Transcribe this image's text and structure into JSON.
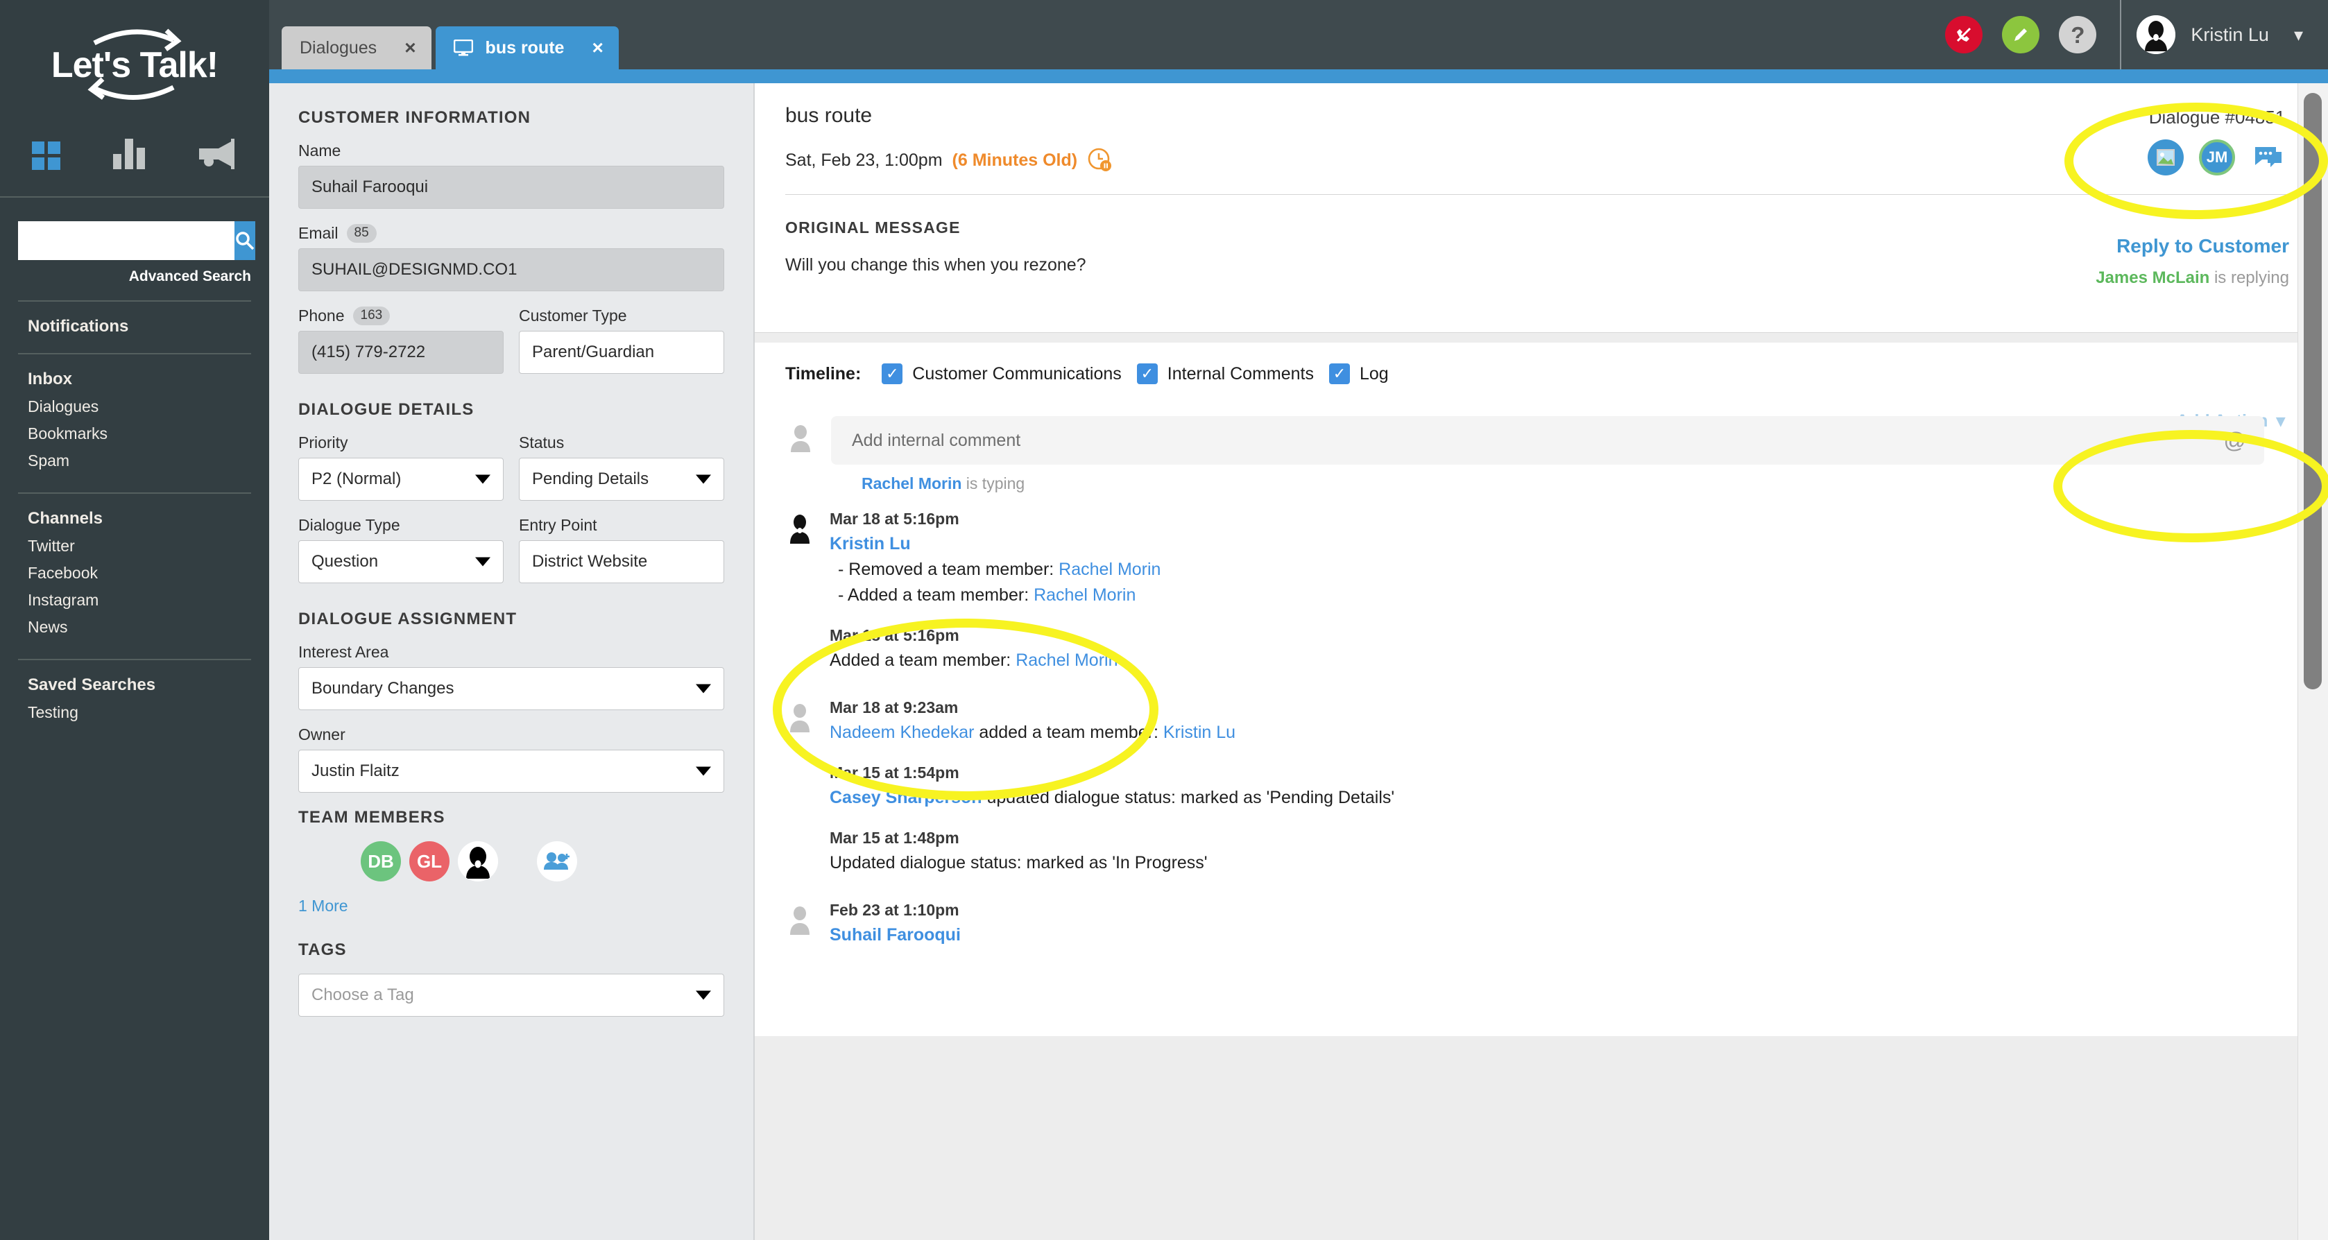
{
  "brand": {
    "name": "Let's Talk!",
    "accent": "#3f96d2",
    "sidebar_bg": "#333e42"
  },
  "sidebar": {
    "search": {
      "value": "",
      "placeholder": ""
    },
    "advanced_search_label": "Advanced Search",
    "notifications_label": "Notifications",
    "groups": [
      {
        "head": "Inbox",
        "items": [
          "Dialogues",
          "Bookmarks",
          "Spam"
        ]
      },
      {
        "head": "Channels",
        "items": [
          "Twitter",
          "Facebook",
          "Instagram",
          "News"
        ]
      },
      {
        "head": "Saved Searches",
        "items": [
          "Testing"
        ]
      }
    ]
  },
  "topbar": {
    "tabs": [
      {
        "label": "Dialogues",
        "active": false,
        "close": "×"
      },
      {
        "label": "bus route",
        "active": true,
        "close": "×"
      }
    ],
    "icons": [
      "phone-off-icon",
      "pencil-icon",
      "help-icon"
    ],
    "user": {
      "name": "Kristin Lu",
      "caret": "⌄"
    }
  },
  "detail_panel": {
    "customer_information": {
      "title": "CUSTOMER INFORMATION",
      "name": {
        "label": "Name",
        "value": "Suhail Farooqui"
      },
      "email": {
        "label": "Email",
        "count": "85",
        "value": "SUHAIL@DESIGNMD.CO1"
      },
      "phone": {
        "label": "Phone",
        "count": "163",
        "value": "(415) 779-2722"
      },
      "customer_type": {
        "label": "Customer Type",
        "value": "Parent/Guardian"
      }
    },
    "dialogue_details": {
      "title": "DIALOGUE DETAILS",
      "priority": {
        "label": "Priority",
        "value": "P2 (Normal)"
      },
      "status": {
        "label": "Status",
        "value": "Pending Details"
      },
      "dialogue_type": {
        "label": "Dialogue Type",
        "value": "Question"
      },
      "entry_point": {
        "label": "Entry Point",
        "value": "District Website"
      }
    },
    "dialogue_assignment": {
      "title": "DIALOGUE ASSIGNMENT",
      "interest_area": {
        "label": "Interest Area",
        "value": "Boundary Changes"
      },
      "owner": {
        "label": "Owner",
        "value": "Justin Flaitz"
      }
    },
    "team_members": {
      "title": "TEAM MEMBERS",
      "avatars": [
        {
          "initials": "DB",
          "color": "#6cc47e"
        },
        {
          "initials": "GL",
          "color": "#ea6368"
        },
        {
          "initials": "",
          "color": "#ffffff",
          "type": "photo"
        }
      ],
      "add_label": "add-team-member",
      "more_label": "1 More"
    },
    "tags": {
      "title": "TAGS",
      "placeholder": "Choose a Tag"
    }
  },
  "main": {
    "dialogue_title": "bus route",
    "date": "Sat, Feb 23, 1:00pm",
    "age": "(6 Minutes Old)",
    "dialogue_number": "Dialogue #04851",
    "original_message_label": "ORIGINAL MESSAGE",
    "original_message": "Will you change this when you rezone?",
    "reply_link": "Reply to Customer",
    "replying_name": "James McLain",
    "replying_suffix": " is replying",
    "jm_initials": "JM",
    "timeline": {
      "label": "Timeline:",
      "filters": [
        {
          "label": "Customer Communications",
          "checked": true
        },
        {
          "label": "Internal Comments",
          "checked": true
        },
        {
          "label": "Log",
          "checked": true
        }
      ],
      "add_action_label": "Add Action",
      "comment_placeholder": "Add internal comment",
      "typing_name": "Rachel Morin",
      "typing_suffix": " is typing",
      "entries": [
        {
          "time": "Mar 18 at 5:16pm",
          "actor": "Kristin Lu",
          "actor_link": true,
          "has_avatar": true,
          "avatar_type": "photo",
          "lines": [
            {
              "prefix": "-  Removed a team member: ",
              "link": "Rachel Morin",
              "suffix": "",
              "indent": true
            },
            {
              "prefix": "-  Added a team member: ",
              "link": "Rachel Morin",
              "suffix": "",
              "indent": true
            }
          ]
        },
        {
          "time": "Mar 18 at 5:16pm",
          "actor": "",
          "has_avatar": false,
          "lines": [
            {
              "prefix": "Added a team member: ",
              "link": "Rachel Morin",
              "suffix": "",
              "indent": false
            }
          ]
        },
        {
          "time": "Mar 18 at 9:23am",
          "actor": "",
          "has_avatar": true,
          "avatar_type": "generic",
          "lines": [
            {
              "prefix": "",
              "link": "Nadeem Khedekar",
              "mid": " added a team member: ",
              "link2": "Kristin Lu",
              "suffix": "",
              "indent": false
            }
          ]
        },
        {
          "time": "Mar 15 at 1:54pm",
          "actor": "",
          "has_avatar": false,
          "lines": [
            {
              "prefix": "",
              "link": "Casey Sharperson",
              "mid": " updated dialogue status: marked as 'Pending Details'",
              "suffix": "",
              "indent": false
            }
          ]
        },
        {
          "time": "Mar 15 at 1:48pm",
          "actor": "",
          "has_avatar": false,
          "lines": [
            {
              "prefix": "Updated dialogue status: marked as 'In Progress'",
              "indent": false
            }
          ]
        },
        {
          "time": "Feb 23 at 1:10pm",
          "actor": "Suhail Farooqui",
          "actor_link": true,
          "has_avatar": true,
          "avatar_type": "generic",
          "lines": []
        }
      ]
    }
  }
}
